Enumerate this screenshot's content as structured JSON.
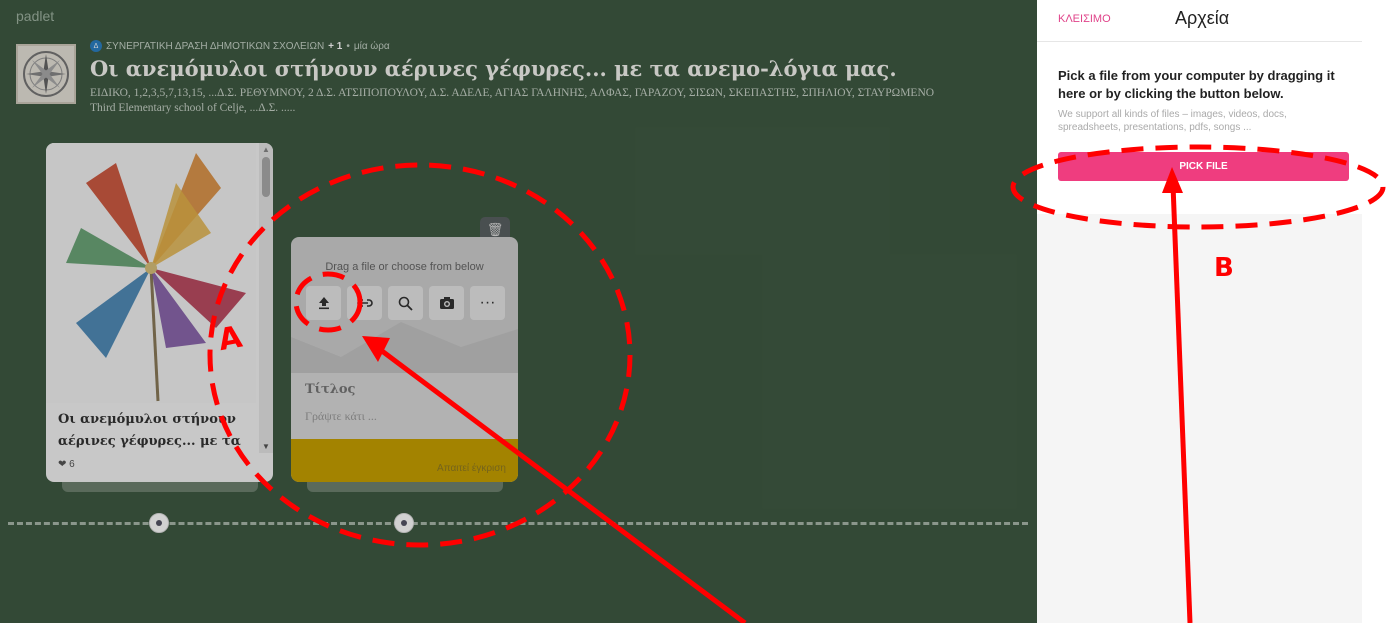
{
  "brand": "padlet",
  "board": {
    "meta": {
      "avatar_letter": "Δ",
      "author": "ΣΥΝΕΡΓΑΤΙΚΗ ΔΡΑΣΗ ΔΗΜΟΤΙΚΩΝ ΣΧΟΛΕΙΩΝ",
      "plus": "+ 1",
      "separator": "•",
      "time": "μία ώρα"
    },
    "title": "Οι ανεμόμυλοι στήνουν αέρινες γέφυρες... με τα ανεμο-λόγια μας.",
    "subtitle_line1": "ΕΙΔΙΚΟ, 1,2,3,5,7,13,15, ...Δ.Σ. ΡΕΘΥΜΝΟΥ, 2 Δ.Σ. ΑΤΣΙΠΟΠΟΥΛΟΥ, Δ.Σ. ΑΔΕΛΕ, ΑΓΙΑΣ ΓΑΛΗΝΗΣ, ΑΛΦΑΣ, ΓΑΡΑΖΟΥ, ΣΙΣΩΝ, ΣΚΕΠΑΣΤΗΣ, ΣΠΗΛΙΟΥ, ΣΤΑΥΡΩΜΕΝΟ",
    "subtitle_line2": "Third Elementary school of Celje, ...Δ.Σ. ....."
  },
  "card1": {
    "heading": "Οι ανεμόμυλοι στήνουν αέρινες γέφυρες... με τα",
    "likes": "6"
  },
  "card2": {
    "drag_text": "Drag a file or choose from below",
    "tools": [
      "upload-icon",
      "link-icon",
      "search-icon",
      "camera-icon",
      "more-icon"
    ],
    "more_label": "···",
    "title_placeholder": "Τίτλος",
    "body_placeholder": "Γράψτε κάτι ...",
    "footer": "Απαιτεί έγκριση"
  },
  "panel": {
    "close_label": "ΚΛΕΙΣΙΜΟ",
    "title": "Αρχεία",
    "instruction": "Pick a file from your computer by dragging it here or by clicking the button below.",
    "support": "We support all kinds of files – images, videos, docs, spreadsheets, presentations, pdfs, songs ...",
    "pick_button": "PICK FILE"
  },
  "annotations": {
    "label_a": "A",
    "label_b": "B",
    "color": "#ff0000"
  }
}
